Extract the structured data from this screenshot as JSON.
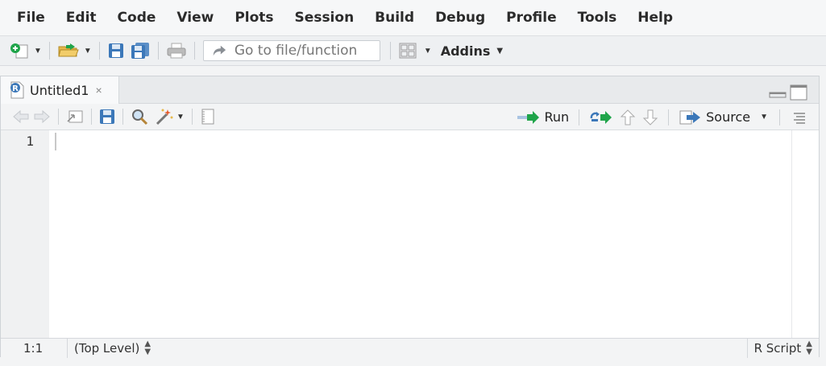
{
  "menu": [
    "File",
    "Edit",
    "Code",
    "View",
    "Plots",
    "Session",
    "Build",
    "Debug",
    "Profile",
    "Tools",
    "Help"
  ],
  "toolbar": {
    "goto_placeholder": "Go to file/function",
    "addins_label": "Addins"
  },
  "tab": {
    "label": "Untitled1",
    "close": "×",
    "icon_letter": "R"
  },
  "editor_toolbar": {
    "run_label": "Run",
    "source_label": "Source"
  },
  "editor": {
    "line_numbers": [
      "1"
    ],
    "content": ""
  },
  "status": {
    "position": "1:1",
    "scope": "(Top Level)",
    "file_type": "R Script"
  },
  "colors": {
    "accent_green": "#1fa44a",
    "accent_blue": "#3c78b9"
  }
}
